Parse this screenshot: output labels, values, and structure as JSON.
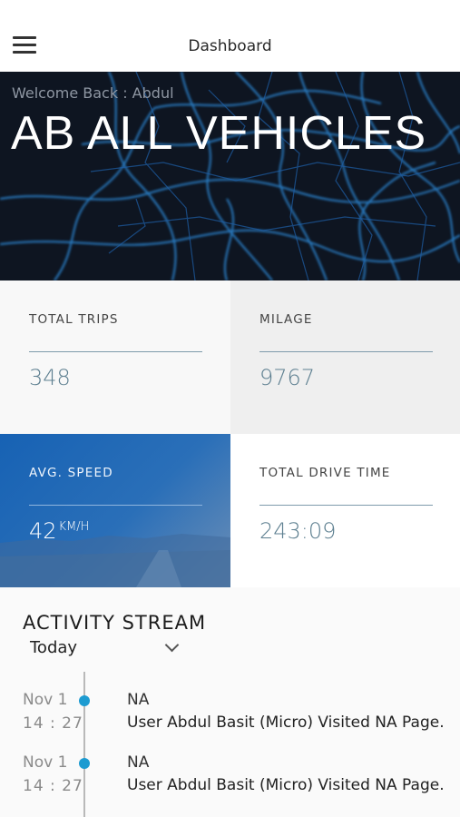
{
  "header": {
    "title": "Dashboard",
    "menu_icon": "hamburger-menu-icon"
  },
  "hero": {
    "welcome": "Welcome Back : Abdul",
    "headline": "AB ALL VEHICLES"
  },
  "stats": {
    "total_trips": {
      "label": "TOTAL TRIPS",
      "value": "348"
    },
    "milage": {
      "label": "MILAGE",
      "value": "9767"
    },
    "avg_speed": {
      "label": "AVG. SPEED",
      "value": "42",
      "unit": "KM/H"
    },
    "total_drive_time": {
      "label": "TOTAL DRIVE TIME",
      "value": "243:09"
    }
  },
  "activity": {
    "heading": "ACTIVITY STREAM",
    "filter": {
      "selected": "Today"
    },
    "entries": [
      {
        "date": "Nov 1",
        "time": "14 : 27",
        "title": "NA",
        "description": "User Abdul Basit (Micro) Visited NA Page."
      },
      {
        "date": "Nov 1",
        "time": "14 : 27",
        "title": "NA",
        "description": "User Abdul Basit (Micro) Visited NA Page."
      }
    ]
  },
  "colors": {
    "accent": "#1d9bd1",
    "stat_value": "#5d7f90",
    "hero_bg": "#0e1521",
    "speed_tile": "#1762b4"
  }
}
